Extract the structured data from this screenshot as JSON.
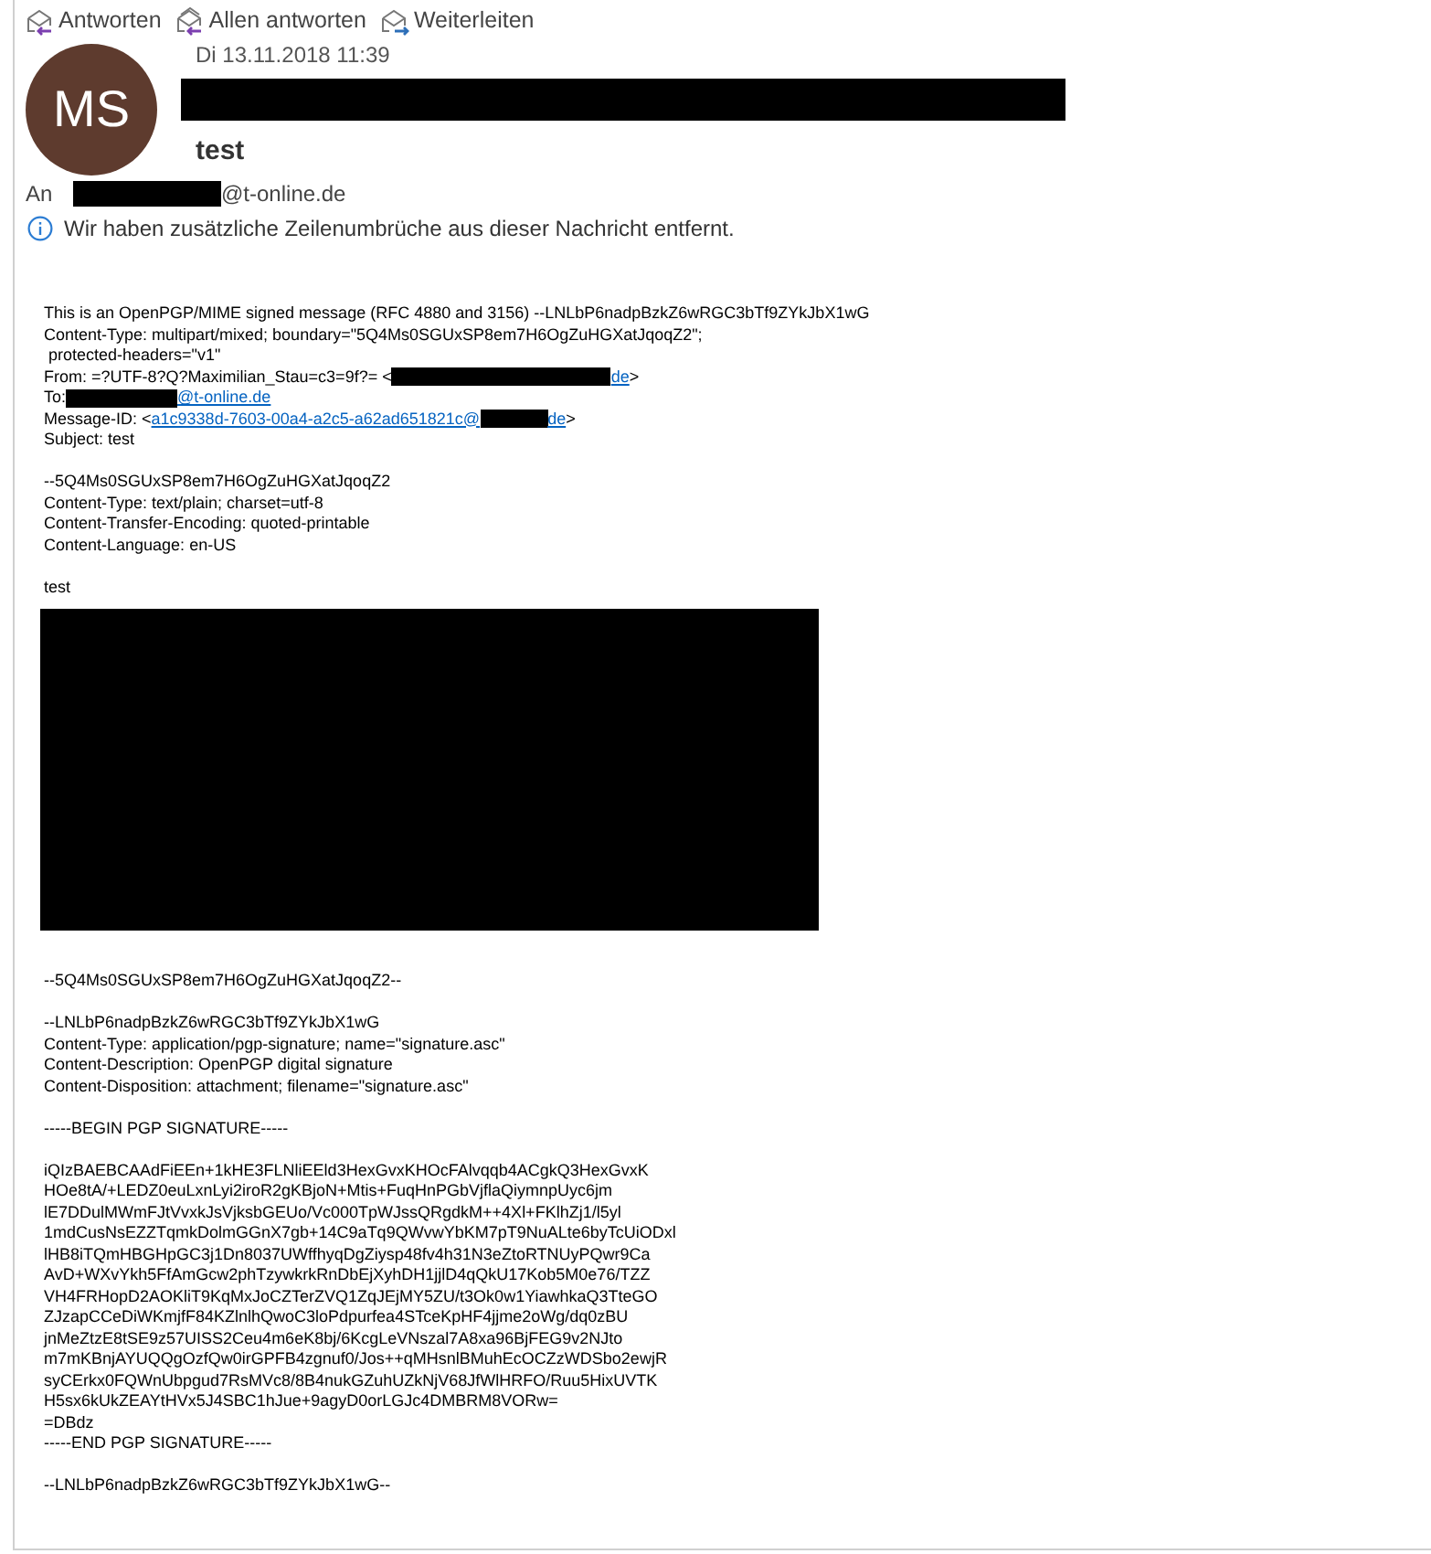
{
  "actions": [
    {
      "label": "Antworten",
      "kind": "reply"
    },
    {
      "label": "Allen antworten",
      "kind": "reply_all"
    },
    {
      "label": "Weiterleiten",
      "kind": "forward"
    }
  ],
  "header": {
    "avatar_initials": "MS",
    "date": "Di 13.11.2018 11:39",
    "subject": "test",
    "to_label": "An",
    "to_address": "@t-online.de",
    "info": "Wir haben zusätzliche Zeilenumbrüche aus dieser Nachricht entfernt."
  },
  "body": [
    {
      "kind": "lines",
      "lines": [
        [
          {
            "kind": "text",
            "text": "This is an OpenPGP/MIME signed message (RFC 4880 and 3156) --LNLbP6nadpBzkZ6wRGC3bTf9ZYkJbX1wG"
          }
        ],
        [
          {
            "kind": "text",
            "text": "Content-Type: multipart/mixed; boundary=\"5Q4Ms0SGUxSP8em7H6OgZuHGXatJqoqZ2\";"
          }
        ],
        [
          {
            "kind": "text",
            "text": " protected-headers=\"v1\""
          }
        ],
        [
          {
            "kind": "text",
            "text": "From: =?UTF-8?Q?Maximilian_Stau=c3=9f?= <"
          },
          {
            "kind": "redacted_long"
          },
          {
            "kind": "link",
            "text": "de"
          },
          {
            "kind": "text",
            "text": ">"
          }
        ],
        [
          {
            "kind": "text",
            "text": "To:"
          },
          {
            "kind": "redacted_medium"
          },
          {
            "kind": "link",
            "text": "@t-online.de"
          }
        ],
        [
          {
            "kind": "text",
            "text": "Message-ID: <"
          },
          {
            "kind": "link",
            "text": "a1c9338d-7603-00a4-a2c5-a62ad651821c@"
          },
          {
            "kind": "redacted_short"
          },
          {
            "kind": "link",
            "text": "de"
          },
          {
            "kind": "text",
            "text": ">"
          }
        ],
        [
          {
            "kind": "text",
            "text": "Subject: test"
          }
        ]
      ]
    },
    {
      "kind": "lines",
      "lines": [
        [
          {
            "kind": "text",
            "text": "--5Q4Ms0SGUxSP8em7H6OgZuHGXatJqoqZ2"
          }
        ],
        [
          {
            "kind": "text",
            "text": "Content-Type: text/plain; charset=utf-8"
          }
        ],
        [
          {
            "kind": "text",
            "text": "Content-Transfer-Encoding: quoted-printable"
          }
        ],
        [
          {
            "kind": "text",
            "text": "Content-Language: en-US"
          }
        ]
      ]
    },
    {
      "kind": "lines",
      "lines": [
        [
          {
            "kind": "text",
            "text": "test"
          }
        ]
      ]
    },
    {
      "kind": "redacted_block"
    },
    {
      "kind": "lines",
      "lines": [
        [
          {
            "kind": "text",
            "text": "--5Q4Ms0SGUxSP8em7H6OgZuHGXatJqoqZ2--"
          }
        ]
      ]
    },
    {
      "kind": "lines",
      "lines": [
        [
          {
            "kind": "text",
            "text": "--LNLbP6nadpBzkZ6wRGC3bTf9ZYkJbX1wG"
          }
        ],
        [
          {
            "kind": "text",
            "text": "Content-Type: application/pgp-signature; name=\"signature.asc\""
          }
        ],
        [
          {
            "kind": "text",
            "text": "Content-Description: OpenPGP digital signature"
          }
        ],
        [
          {
            "kind": "text",
            "text": "Content-Disposition: attachment; filename=\"signature.asc\""
          }
        ]
      ]
    },
    {
      "kind": "lines",
      "lines": [
        [
          {
            "kind": "text",
            "text": "-----BEGIN PGP SIGNATURE-----"
          }
        ]
      ]
    },
    {
      "kind": "lines",
      "lines": [
        [
          {
            "kind": "text",
            "text": "iQIzBAEBCAAdFiEEn+1kHE3FLNliEEld3HexGvxKHOcFAlvqqb4ACgkQ3HexGvxK"
          }
        ],
        [
          {
            "kind": "text",
            "text": "HOe8tA/+LEDZ0euLxnLyi2iroR2gKBjoN+Mtis+FuqHnPGbVjflaQiymnpUyc6jm"
          }
        ],
        [
          {
            "kind": "text",
            "text": "lE7DDulMWmFJtVvxkJsVjksbGEUo/Vc000TpWJssQRgdkM++4Xl+FKlhZj1/l5yl"
          }
        ],
        [
          {
            "kind": "text",
            "text": "1mdCusNsEZZTqmkDolmGGnX7gb+14C9aTq9QWvwYbKM7pT9NuALte6byTcUiODxl"
          }
        ],
        [
          {
            "kind": "text",
            "text": "lHB8iTQmHBGHpGC3j1Dn8037UWffhyqDgZiysp48fv4h31N3eZtoRTNUyPQwr9Ca"
          }
        ],
        [
          {
            "kind": "text",
            "text": "AvD+WXvYkh5FfAmGcw2phTzywkrkRnDbEjXyhDH1jjlD4qQkU17Kob5M0e76/TZZ"
          }
        ],
        [
          {
            "kind": "text",
            "text": "VH4FRHopD2AOKliT9KqMxJoCZTerZVQ1ZqJEjMY5ZU/t3Ok0w1YiawhkaQ3TteGO"
          }
        ],
        [
          {
            "kind": "text",
            "text": "ZJzapCCeDiWKmjfF84KZlnlhQwoC3loPdpurfea4STceKpHF4jjme2oWg/dq0zBU"
          }
        ],
        [
          {
            "kind": "text",
            "text": "jnMeZtzE8tSE9z57UISS2Ceu4m6eK8bj/6KcgLeVNszal7A8xa96BjFEG9v2NJto"
          }
        ],
        [
          {
            "kind": "text",
            "text": "m7mKBnjAYUQQgOzfQw0irGPFB4zgnuf0/Jos++qMHsnlBMuhEcOCZzWDSbo2ewjR"
          }
        ],
        [
          {
            "kind": "text",
            "text": "syCErkx0FQWnUbpgud7RsMVc8/8B4nukGZuhUZkNjV68JfWlHRFO/Ruu5HixUVTK"
          }
        ],
        [
          {
            "kind": "text",
            "text": "H5sx6kUkZEAYtHVx5J4SBC1hJue+9agyD0orLGJc4DMBRM8VORw="
          }
        ],
        [
          {
            "kind": "text",
            "text": "=DBdz"
          }
        ],
        [
          {
            "kind": "text",
            "text": "-----END PGP SIGNATURE-----"
          }
        ]
      ]
    },
    {
      "kind": "lines",
      "lines": [
        [
          {
            "kind": "text",
            "text": "--LNLbP6nadpBzkZ6wRGC3bTf9ZYkJbX1wG--"
          }
        ]
      ]
    }
  ]
}
